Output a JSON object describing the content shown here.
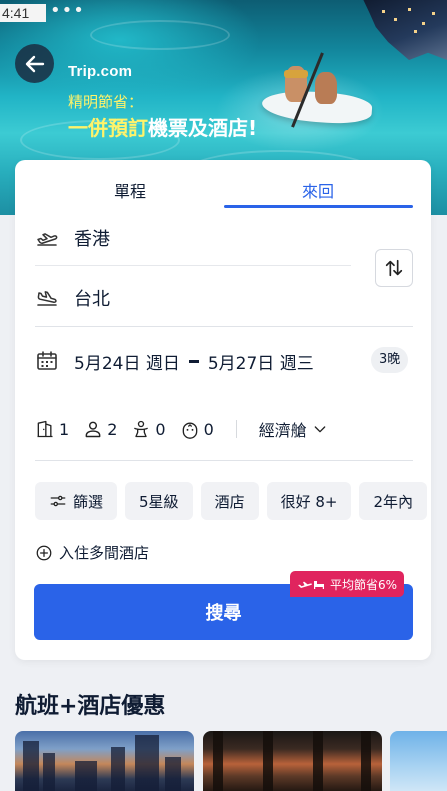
{
  "status_bar": {
    "time": "4:41",
    "dots": "•••",
    "right": "🔋"
  },
  "header": {
    "logo_text": "Trip.com",
    "promo_line1": "精明節省：",
    "promo_line2_highlight": "一併預訂",
    "promo_line2_rest": "機票及酒店!"
  },
  "tabs": [
    {
      "label": "單程",
      "active": false
    },
    {
      "label": "來回",
      "active": true
    }
  ],
  "route": {
    "from": "香港",
    "to": "台北"
  },
  "dates": {
    "depart": "5月24日 週日",
    "return": "5月27日 週三",
    "nights": "3晚"
  },
  "guests": {
    "rooms": "1",
    "adults": "2",
    "children": "0",
    "infants": "0",
    "cabin": "經濟艙"
  },
  "filter_chips": [
    "篩選",
    "5星級",
    "酒店",
    "很好 8+",
    "2年內"
  ],
  "multi_hotel_label": "入住多間酒店",
  "search": {
    "label": "搜尋",
    "badge": "平均節省6%"
  },
  "deals": {
    "title": "航班+酒店優惠"
  },
  "colors": {
    "accent": "#2a63e8",
    "badge": "#e0245e",
    "promo_yellow": "#fff36a"
  },
  "icons": [
    "back-arrow-icon",
    "takeoff-icon",
    "landing-icon",
    "swap-icon",
    "calendar-icon",
    "room-icon",
    "adult-icon",
    "child-icon",
    "infant-icon",
    "chevron-down-icon",
    "filter-icon",
    "plus-circle-icon",
    "plane-bed-icon"
  ]
}
